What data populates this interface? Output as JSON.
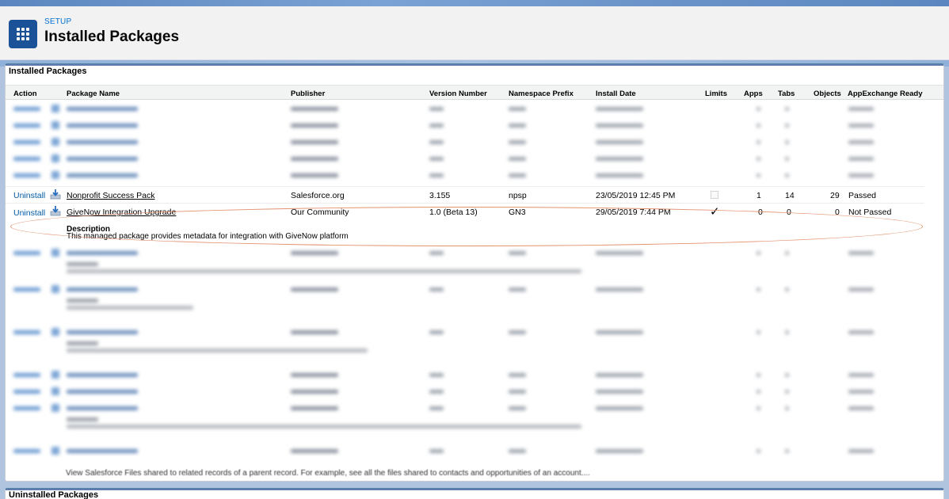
{
  "header": {
    "setup_label": "SETUP",
    "title": "Installed Packages",
    "app_icon": "app-launcher-grid-icon"
  },
  "installed": {
    "section_title": "Installed Packages",
    "columns": [
      "Action",
      "Package Name",
      "Publisher",
      "Version Number",
      "Namespace Prefix",
      "Install Date",
      "Limits",
      "Apps",
      "Tabs",
      "Objects",
      "AppExchange Ready"
    ],
    "rows": [
      {
        "action": "Uninstall",
        "icon": "download-icon",
        "name": "Nonprofit Success Pack",
        "publisher": "Salesforce.org",
        "version": "3.155",
        "namespace": "npsp",
        "install_date": "23/05/2019 12:45 PM",
        "limits": "",
        "apps": "1",
        "tabs": "14",
        "objects": "29",
        "appexchange_ready": "Passed"
      },
      {
        "action": "Uninstall",
        "icon": "download-icon",
        "name": "GiveNow Integration Upgrade",
        "publisher": "Our Community",
        "version": "1.0 (Beta 13)",
        "namespace": "GN3",
        "install_date": "29/05/2019 7:44 PM",
        "limits": "✓",
        "apps": "0",
        "tabs": "0",
        "objects": "0",
        "appexchange_ready": "Not Passed",
        "description_label": "Description",
        "description": "This managed package provides metadata for integration with GiveNow platform"
      }
    ],
    "last_description": "View Salesforce Files shared to related records of a parent record. For example, see all the files shared to contacts and opportunities of an account...."
  },
  "uninstalled": {
    "section_title": "Uninstalled Packages"
  },
  "colors": {
    "link": "#015ba7",
    "app_tile": "#1b5297",
    "highlight": "#e2926f",
    "panel_border": "#5a7fab"
  }
}
